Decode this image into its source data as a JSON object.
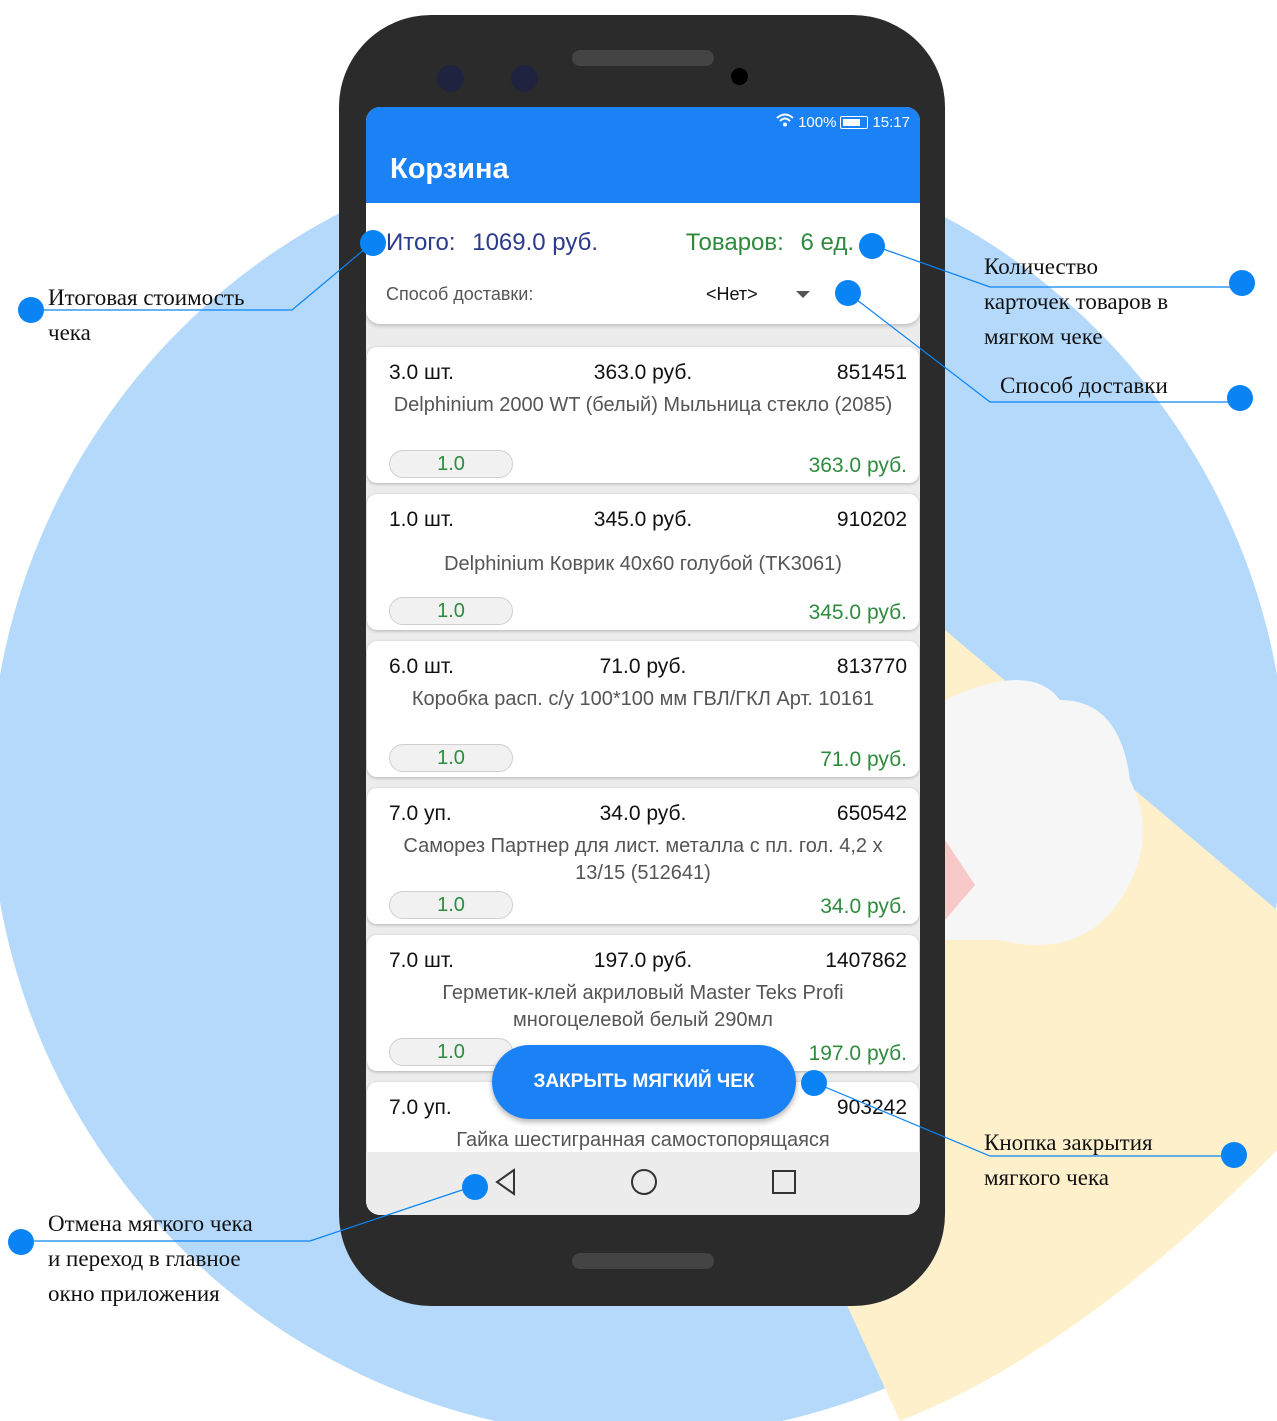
{
  "status": {
    "signal": "100%",
    "time": "15:17"
  },
  "app": {
    "title": "Корзина"
  },
  "summary": {
    "total_label": "Итого:",
    "total_value": "1069.0 руб.",
    "count_label": "Товаров:",
    "count_value": "6 ед.",
    "delivery_label": "Способ доставки:",
    "delivery_value": "<Нет>"
  },
  "items": [
    {
      "qty": "3.0 шт.",
      "price": "363.0 руб.",
      "code": "851451",
      "name": "Delphinium 2000 WT (белый) Мыльница стекло (2085)",
      "count": "1.0",
      "sum": "363.0 руб."
    },
    {
      "qty": "1.0 шт.",
      "price": "345.0 руб.",
      "code": "910202",
      "name": "Delphinium Коврик 40x60 голубой (TK3061)",
      "count": "1.0",
      "sum": "345.0 руб."
    },
    {
      "qty": "6.0 шт.",
      "price": "71.0 руб.",
      "code": "813770",
      "name": "Коробка расп. с/у 100*100 мм ГВЛ/ГКЛ Арт. 10161",
      "count": "1.0",
      "sum": "71.0 руб."
    },
    {
      "qty": "7.0 уп.",
      "price": "34.0 руб.",
      "code": "650542",
      "name": "Саморез Партнер для лист. металла с пл. гол. 4,2 х 13/15 (512641)",
      "count": "1.0",
      "sum": "34.0 руб."
    },
    {
      "qty": "7.0 шт.",
      "price": "197.0 руб.",
      "code": "1407862",
      "name": "Герметик-клей акриловый Master Teks Profi многоцелевой белый 290мл",
      "count": "1.0",
      "sum": "197.0 руб."
    },
    {
      "qty": "7.0 уп.",
      "price": "",
      "code": "903242",
      "name": "Гайка шестигранная самостопорящаяся",
      "count": "",
      "sum": ""
    }
  ],
  "fab": {
    "label": "ЗАКРЫТЬ МЯГКИЙ ЧЕК"
  },
  "annotations": {
    "total": [
      "Итоговая стоимость",
      "чека"
    ],
    "count": [
      "Количество",
      "карточек товаров в",
      "мягком чеке"
    ],
    "delivery": [
      "Способ доставки"
    ],
    "close": [
      "Кнопка закрытия",
      "мягкого чека"
    ],
    "cancel": [
      "Отмена мягкого чека",
      "и переход в главное",
      "окно приложения"
    ]
  },
  "colors": {
    "accent": "#1b82f5",
    "total": "#2b3a8c",
    "green": "#2e8b3e",
    "background": "#b5d9fb",
    "marker": "#0a84f5"
  }
}
